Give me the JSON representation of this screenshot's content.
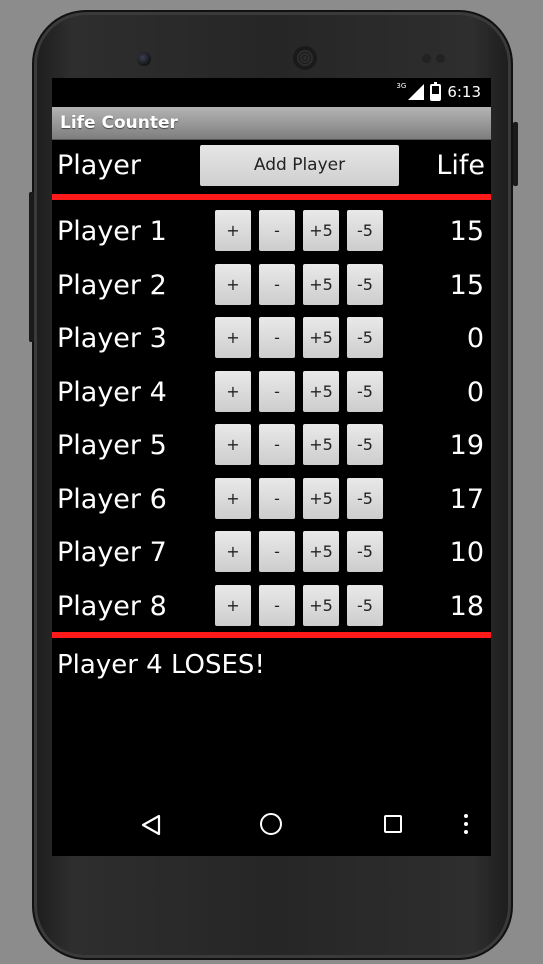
{
  "statusbar": {
    "network": "3G",
    "time": "6:13"
  },
  "app": {
    "title": "Life Counter"
  },
  "header": {
    "player_label": "Player",
    "add_button_label": "Add Player",
    "life_label": "Life"
  },
  "buttons": {
    "plus_one": "+",
    "minus_one": "-",
    "plus_five": "+5",
    "minus_five": "-5"
  },
  "players": [
    {
      "name": "Player 1",
      "life": "15"
    },
    {
      "name": "Player 2",
      "life": "15"
    },
    {
      "name": "Player 3",
      "life": "0"
    },
    {
      "name": "Player 4",
      "life": "0"
    },
    {
      "name": "Player 5",
      "life": "19"
    },
    {
      "name": "Player 6",
      "life": "17"
    },
    {
      "name": "Player 7",
      "life": "10"
    },
    {
      "name": "Player 8",
      "life": "18"
    }
  ],
  "message": "Player 4 LOSES!",
  "colors": {
    "divider": "#ff1a1a",
    "background": "#000000",
    "titlebar": "#9a9a9a"
  },
  "icons": {
    "nav_back": "back-triangle-icon",
    "nav_home": "home-circle-icon",
    "nav_recent": "recent-apps-square-icon",
    "nav_menu": "overflow-menu-icon"
  }
}
